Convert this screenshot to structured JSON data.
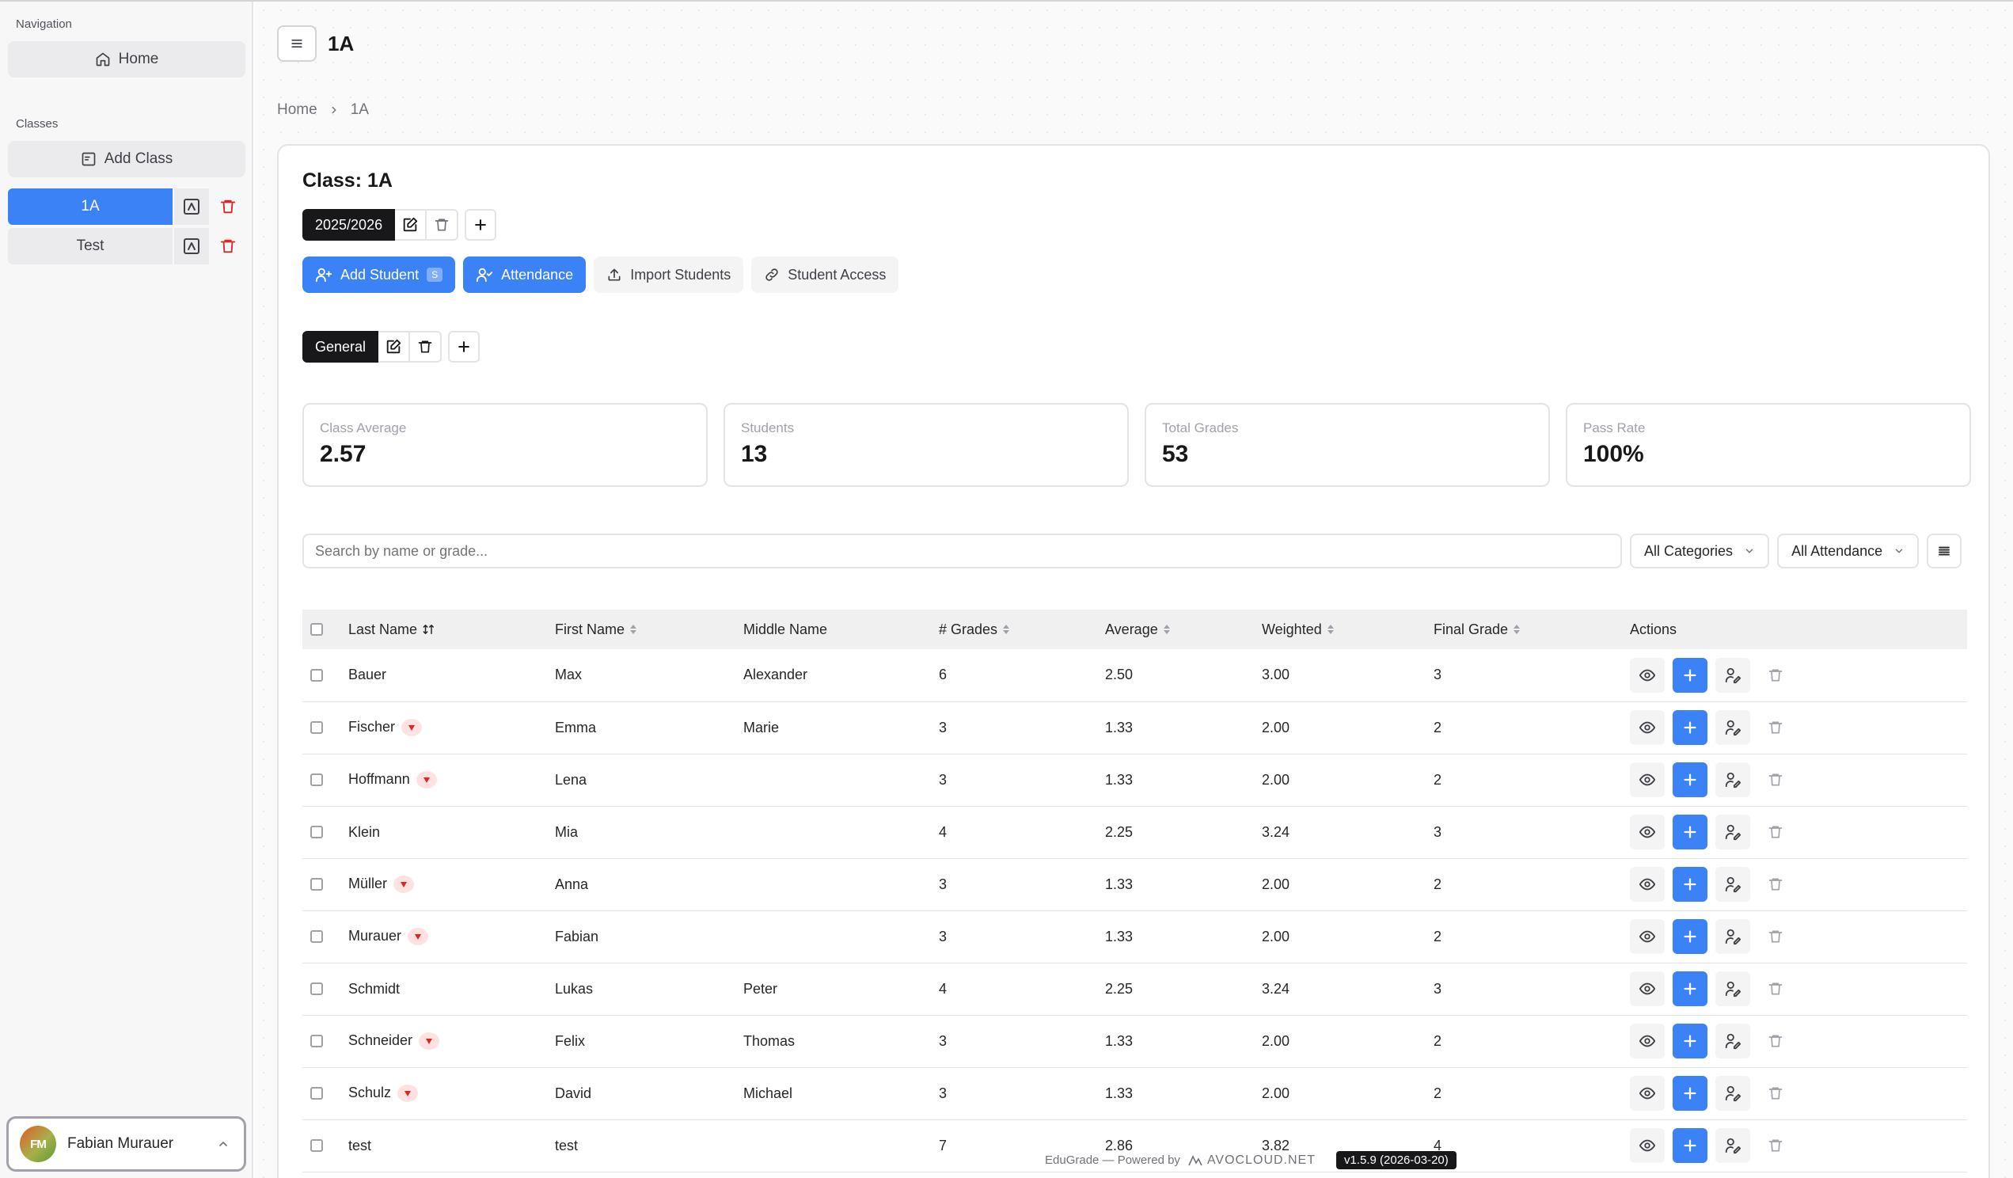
{
  "sidebar": {
    "navigation_label": "Navigation",
    "home_label": "Home",
    "classes_label": "Classes",
    "add_class_label": "Add Class",
    "classes": [
      {
        "name": "1A",
        "active": true
      },
      {
        "name": "Test",
        "active": false
      }
    ],
    "user": {
      "initials": "FM",
      "name": "Fabian Murauer"
    }
  },
  "header": {
    "title": "1A"
  },
  "breadcrumb": {
    "home": "Home",
    "current": "1A"
  },
  "class_card": {
    "title": "Class: 1A",
    "school_year": "2025/2026",
    "actions": {
      "add_student": "Add Student",
      "add_student_shortcut": "S",
      "attendance": "Attendance",
      "import_students": "Import Students",
      "student_access": "Student Access"
    },
    "category": "General",
    "stats": [
      {
        "label": "Class Average",
        "value": "2.57"
      },
      {
        "label": "Students",
        "value": "13"
      },
      {
        "label": "Total Grades",
        "value": "53"
      },
      {
        "label": "Pass Rate",
        "value": "100%"
      }
    ],
    "search_placeholder": "Search by name or grade...",
    "category_filter": "All Categories",
    "attendance_filter": "All Attendance"
  },
  "table": {
    "headers": {
      "last_name": "Last Name",
      "first_name": "First Name",
      "middle_name": "Middle Name",
      "grades": "# Grades",
      "average": "Average",
      "weighted": "Weighted",
      "final_grade": "Final Grade",
      "actions": "Actions"
    },
    "rows": [
      {
        "last": "Bauer",
        "first": "Max",
        "middle": "Alexander",
        "grades": "6",
        "average": "2.50",
        "weighted": "3.00",
        "final": "3",
        "flag": false
      },
      {
        "last": "Fischer",
        "first": "Emma",
        "middle": "Marie",
        "grades": "3",
        "average": "1.33",
        "weighted": "2.00",
        "final": "2",
        "flag": true
      },
      {
        "last": "Hoffmann",
        "first": "Lena",
        "middle": "",
        "grades": "3",
        "average": "1.33",
        "weighted": "2.00",
        "final": "2",
        "flag": true
      },
      {
        "last": "Klein",
        "first": "Mia",
        "middle": "",
        "grades": "4",
        "average": "2.25",
        "weighted": "3.24",
        "final": "3",
        "flag": false
      },
      {
        "last": "Müller",
        "first": "Anna",
        "middle": "",
        "grades": "3",
        "average": "1.33",
        "weighted": "2.00",
        "final": "2",
        "flag": true
      },
      {
        "last": "Murauer",
        "first": "Fabian",
        "middle": "",
        "grades": "3",
        "average": "1.33",
        "weighted": "2.00",
        "final": "2",
        "flag": true
      },
      {
        "last": "Schmidt",
        "first": "Lukas",
        "middle": "Peter",
        "grades": "4",
        "average": "2.25",
        "weighted": "3.24",
        "final": "3",
        "flag": false
      },
      {
        "last": "Schneider",
        "first": "Felix",
        "middle": "Thomas",
        "grades": "3",
        "average": "1.33",
        "weighted": "2.00",
        "final": "2",
        "flag": true
      },
      {
        "last": "Schulz",
        "first": "David",
        "middle": "Michael",
        "grades": "3",
        "average": "1.33",
        "weighted": "2.00",
        "final": "2",
        "flag": true
      },
      {
        "last": "test",
        "first": "test",
        "middle": "",
        "grades": "7",
        "average": "2.86",
        "weighted": "3.82",
        "final": "4",
        "flag": false
      }
    ]
  },
  "footer": {
    "powered_text": "EduGrade — Powered by",
    "brand": "AVOCLOUD.NET",
    "version": "v1.5.9 (2026-03-20)"
  },
  "colors": {
    "accent": "#3b82f6",
    "danger": "#dc2626",
    "dark": "#18181b"
  }
}
